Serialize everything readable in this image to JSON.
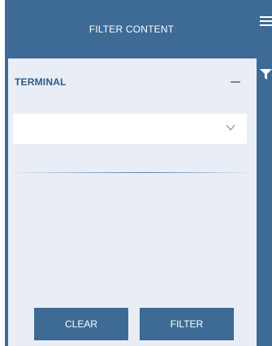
{
  "header": {
    "title": "FILTER CONTENT"
  },
  "section": {
    "title": "TERMINAL"
  },
  "terminal_select": {
    "value": ""
  },
  "buttons": {
    "clear_label": "CLEAR",
    "filter_label": "FILTER"
  },
  "icons": {
    "menu": "hamburger-menu-icon",
    "filter": "funnel-filter-icon",
    "collapse": "minus-icon",
    "dropdown": "chevron-down-icon"
  },
  "colors": {
    "primary": "#3d6b95",
    "panel_background": "#e9eef6",
    "section_title": "#2e5b85"
  }
}
